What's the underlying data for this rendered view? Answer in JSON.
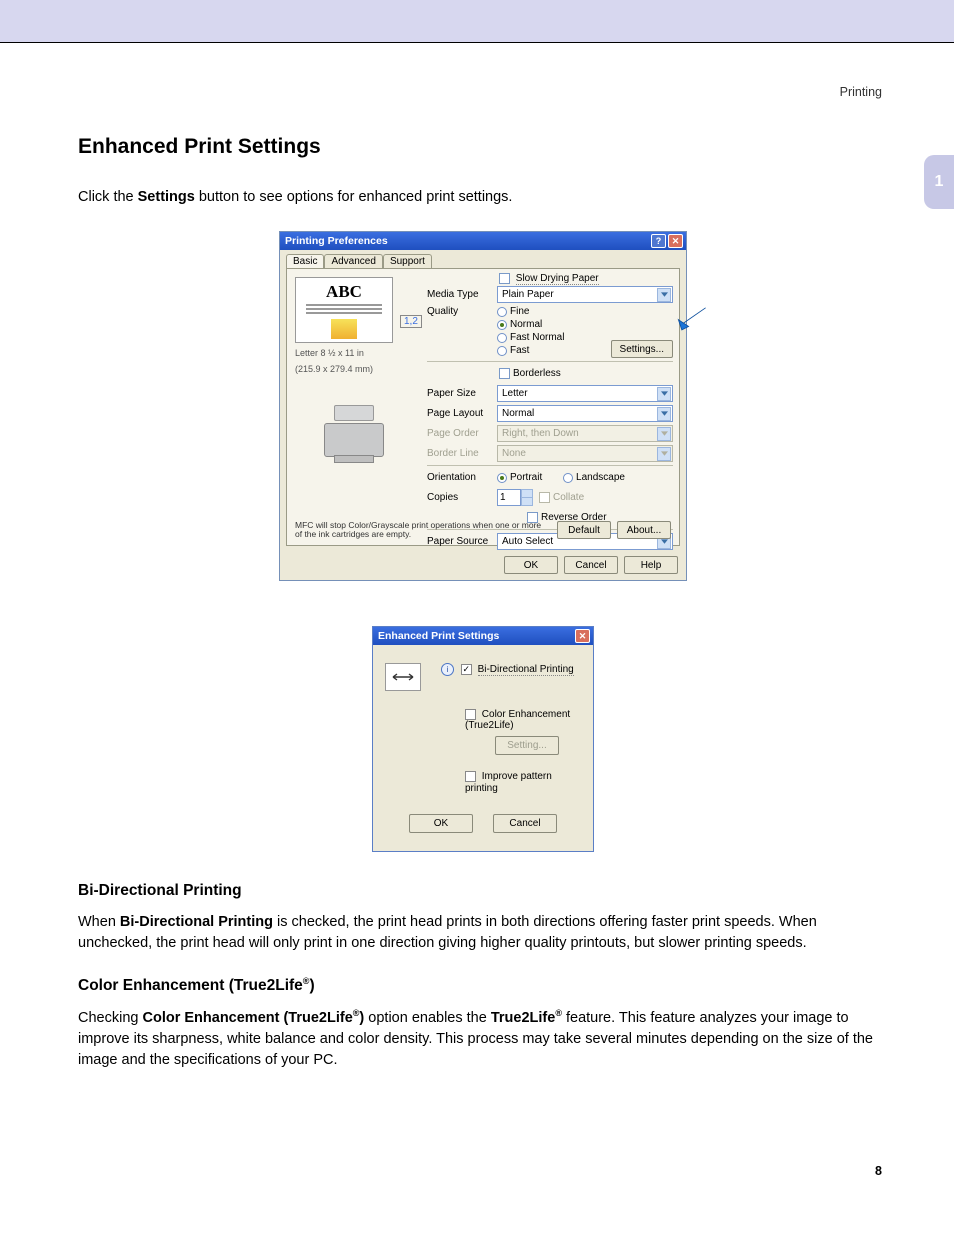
{
  "header": {
    "section_label": "Printing",
    "page_number": "8",
    "chapter_tab": "1"
  },
  "headings": {
    "h1": "Enhanced Print Settings",
    "h2a": "Bi-Directional Printing",
    "h2b_prefix": "Color Enhancement (True2Life",
    "h2b_suffix": ")"
  },
  "intro": {
    "pre": "Click the ",
    "bold": "Settings",
    "post": " button to see options for enhanced print settings."
  },
  "para_bidi": {
    "pre": "When ",
    "bold": "Bi-Directional Printing",
    "post": " is checked, the print head prints in both directions offering faster print speeds. When unchecked, the print head will only print in one direction giving higher quality printouts, but slower printing speeds."
  },
  "para_color": {
    "t1": "Checking ",
    "b1a": "Color Enhancement (True2Life",
    "b1b": ")",
    "t2": " option enables the ",
    "b2": "True2Life",
    "t3": " feature. This feature analyzes your image to improve its sharpness, white balance and color density. This process may take several minutes depending on the size of the image and the specifications of your PC."
  },
  "dialog1": {
    "title": "Printing Preferences",
    "tabs": [
      "Basic",
      "Advanced",
      "Support"
    ],
    "preview_text": "ABC",
    "preview_badge": "1,2",
    "size_lbl1": "Letter 8 ½ x 11 in",
    "size_lbl2": "(215.9 x 279.4 mm)",
    "slow_dry": "Slow Drying Paper",
    "labels": {
      "media_type": "Media Type",
      "quality": "Quality",
      "borderless": "Borderless",
      "paper_size": "Paper Size",
      "page_layout": "Page Layout",
      "page_order": "Page Order",
      "border_line": "Border Line",
      "orientation": "Orientation",
      "copies": "Copies",
      "paper_source": "Paper Source"
    },
    "media_type_val": "Plain Paper",
    "quality": {
      "fine": "Fine",
      "normal": "Normal",
      "fast_normal": "Fast Normal",
      "fast": "Fast"
    },
    "settings_btn": "Settings...",
    "paper_size_val": "Letter",
    "page_layout_val": "Normal",
    "page_order_val": "Right, then Down",
    "border_line_val": "None",
    "orientation": {
      "portrait": "Portrait",
      "landscape": "Landscape"
    },
    "copies_val": "1",
    "collate": "Collate",
    "reverse": "Reverse Order",
    "paper_source_val": "Auto Select",
    "note": "MFC will stop Color/Grayscale print operations when one or more of the ink cartridges are empty.",
    "btn_default": "Default",
    "btn_about": "About...",
    "btn_ok": "OK",
    "btn_cancel": "Cancel",
    "btn_help": "Help"
  },
  "dialog2": {
    "title": "Enhanced Print Settings",
    "bidi": "Bi-Directional Printing",
    "color_enh": "Color Enhancement (True2Life)",
    "setting_btn": "Setting...",
    "improve": "Improve pattern printing",
    "ok": "OK",
    "cancel": "Cancel"
  }
}
